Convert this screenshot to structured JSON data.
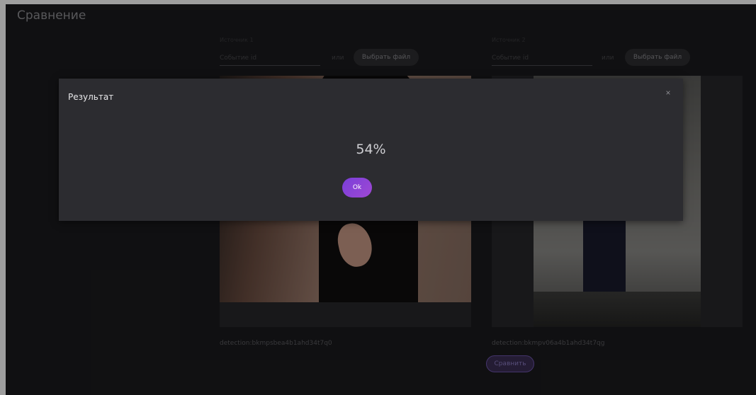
{
  "page": {
    "title": "Сравнение"
  },
  "sources": [
    {
      "label": "Источник 1",
      "event_placeholder": "Событие id",
      "or_text": "или",
      "choose_file_label": "Выбрать файл",
      "detection_id": "detection:bkmpsbea4b1ahd34t7q0"
    },
    {
      "label": "Источник 2",
      "event_placeholder": "Событие id",
      "or_text": "или",
      "choose_file_label": "Выбрать файл",
      "detection_id": "detection:bkmpv06a4b1ahd34t7qg"
    }
  ],
  "compare_button_label": "Сравнить",
  "modal": {
    "title": "Результат",
    "close_glyph": "×",
    "result": "54%",
    "ok_label": "Ok"
  },
  "colors": {
    "background": "#1b1b1d",
    "modal_background": "#2c2c30",
    "accent": "#8e44d6"
  }
}
